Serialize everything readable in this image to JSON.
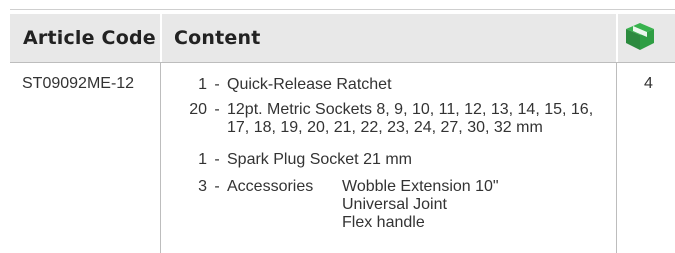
{
  "table": {
    "headers": {
      "article_code": "Article Code",
      "content": "Content",
      "quantity_icon": "box-icon"
    },
    "row": {
      "article_code": "ST09092ME-12",
      "quantity": "4",
      "items": [
        {
          "qty": "1",
          "desc": "Quick-Release Ratchet"
        },
        {
          "qty": "20",
          "desc": "12pt. Metric Sockets 8, 9, 10, 11, 12, 13, 14, 15, 16,",
          "desc2": "17, 18, 19, 20, 21, 22, 23, 24, 27, 30, 32 mm"
        },
        {
          "qty": "1",
          "desc": "Spark Plug Socket 21 mm"
        },
        {
          "qty": "3",
          "desc": "Accessories",
          "subitems": [
            "Wobble Extension 10\"",
            "Universal Joint",
            "Flex handle"
          ]
        }
      ]
    }
  },
  "colors": {
    "header_bg": "#e8e8e8",
    "icon_green": "#2e9e46"
  }
}
